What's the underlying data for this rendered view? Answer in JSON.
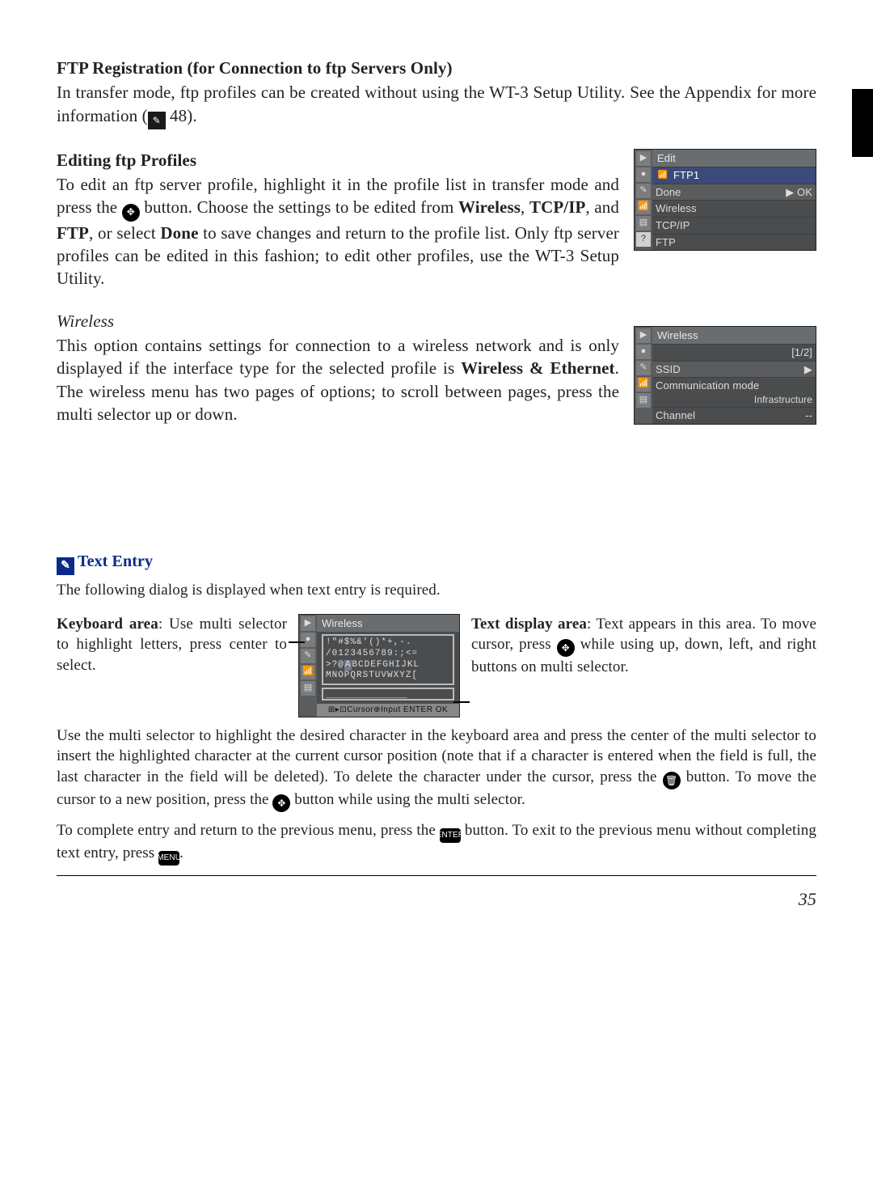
{
  "sections": {
    "ftp_reg": {
      "heading": "FTP Registration (for Connection to ftp Servers Only)",
      "body_parts": [
        "In transfer mode, ftp profiles can be created without using the WT-3 Setup Utility. See the Appendix for more information (",
        " 48)."
      ]
    },
    "edit_ftp": {
      "heading": "Editing ftp Profiles",
      "body_parts": [
        "To edit an ftp server profile, highlight it in the profile list in transfer mode and press the ",
        " button.  Choose the settings to be edited from ",
        "Wireless",
        ", ",
        "TCP/IP",
        ", and ",
        "FTP",
        ", or select ",
        "Done",
        " to save changes and return to the profile list.  Only ftp server profiles can be edited in this fashion; to edit other profiles, use the WT-3 Setup Utility."
      ]
    },
    "wireless": {
      "heading": "Wireless",
      "body_parts": [
        "This option contains settings for connection to a wireless network and is only displayed if the interface type for the selected profile is ",
        "Wireless & Ethernet",
        ".  The wireless menu has two pages of options; to scroll between pages, press the multi selector up or down."
      ]
    }
  },
  "lcd_edit": {
    "title": "Edit",
    "profile": "FTP1",
    "items": [
      {
        "label": "Done",
        "right": "▶ OK"
      },
      {
        "label": "Wireless"
      },
      {
        "label": "TCP/IP"
      },
      {
        "label": "FTP"
      }
    ]
  },
  "lcd_wireless": {
    "title": "Wireless",
    "page": "[1/2]",
    "items": [
      {
        "label": "SSID",
        "arrow": "▶"
      },
      {
        "label": "Communication mode",
        "value": "Infrastructure"
      },
      {
        "label": "Channel",
        "value": "--"
      }
    ]
  },
  "text_entry": {
    "title": "Text Entry",
    "intro": "The following dialog is displayed when text entry is required.",
    "left_label": "Keyboard area",
    "left_body": ": Use multi selector to highlight letters, press center to select.",
    "right_label": "Text display area",
    "right_body_parts": [
      ": Text appears in this area.  To move cursor, press ",
      " while using up, down, left, and right buttons on multi selector."
    ],
    "lcd": {
      "title": "Wireless",
      "rows": [
        "!\"#$%&'()*+,-.",
        "/0123456789:;<=",
        ">?@ABCDEFGHIJKL",
        "MNOPQRSTUVWXYZ["
      ],
      "input": "_______________",
      "footer": "⊞▸⊡Cursor⊕Input ENTER OK"
    },
    "body1_parts": [
      "Use the multi selector to highlight the desired character in the keyboard area and press the center of the multi selector to insert the highlighted character at the current cursor position (note that if a character is entered when the field is full, the last character in the field will be deleted).  To delete the character under the cursor, press the ",
      " button.  To move the cursor to a new position, press the ",
      " button while using the multi selector."
    ],
    "body2_parts": [
      "To complete entry and return to the previous menu, press the ",
      " button.  To exit to the previous menu without completing text entry, press ",
      "."
    ]
  },
  "page_number": "35"
}
